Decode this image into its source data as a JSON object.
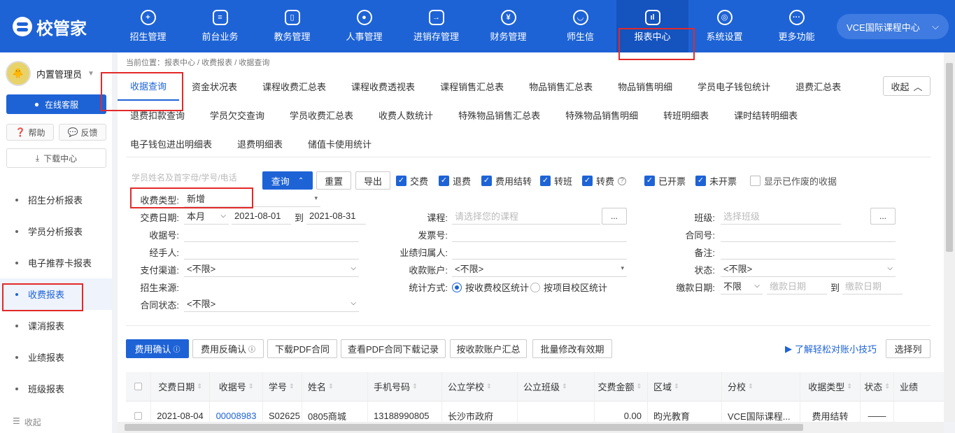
{
  "header": {
    "brand": "校管家",
    "nav": [
      {
        "label": "招生管理",
        "icon": "person-add-icon",
        "glyph": "+"
      },
      {
        "label": "前台业务",
        "icon": "desk-icon",
        "glyph": "≡"
      },
      {
        "label": "教务管理",
        "icon": "book-icon",
        "glyph": "▯"
      },
      {
        "label": "人事管理",
        "icon": "person-icon",
        "glyph": "●"
      },
      {
        "label": "进销存管理",
        "icon": "inventory-icon",
        "glyph": "→"
      },
      {
        "label": "财务管理",
        "icon": "yen-icon",
        "glyph": "¥"
      },
      {
        "label": "师生信",
        "icon": "chat-icon",
        "glyph": "◡"
      },
      {
        "label": "报表中心",
        "icon": "report-icon",
        "glyph": "ıl"
      },
      {
        "label": "系统设置",
        "icon": "settings-icon",
        "glyph": "◎"
      },
      {
        "label": "更多功能",
        "icon": "more-icon",
        "glyph": "···"
      }
    ],
    "org": "VCE国际课程中心"
  },
  "sidebar": {
    "user": "内置管理员",
    "service": "在线客服",
    "help": "帮助",
    "feedback": "反馈",
    "download": "下载中心",
    "items": [
      "招生分析报表",
      "学员分析报表",
      "电子推荐卡报表",
      "收费报表",
      "课消报表",
      "业绩报表",
      "班级报表"
    ],
    "collapse": "收起"
  },
  "breadcrumb": "当前位置：报表中心 / 收费报表 / 收据查询",
  "tabs": {
    "row1": [
      "收据查询",
      "资金状况表",
      "课程收费汇总表",
      "课程收费透视表",
      "课程销售汇总表",
      "物品销售汇总表",
      "物品销售明细",
      "学员电子钱包统计",
      "退费汇总表"
    ],
    "row2": [
      "退费扣款查询",
      "学员欠交查询",
      "学员收费汇总表",
      "收费人数统计",
      "特殊物品销售汇总表",
      "特殊物品销售明细",
      "转班明细表",
      "课时结转明细表"
    ],
    "row3": [
      "电子钱包进出明细表",
      "退费明细表",
      "储值卡使用统计"
    ],
    "fold": "收起"
  },
  "filters": {
    "search_placeholder": "学员姓名及首字母/学号/电话",
    "query": "查询",
    "reset": "重置",
    "export": "导出",
    "checks": [
      "交费",
      "退费",
      "费用结转",
      "转班",
      "转费",
      "已开票",
      "未开票"
    ],
    "show_void": "显示已作废的收据",
    "fee_type_label": "收费类型:",
    "fee_type": "新增",
    "date_label": "交费日期:",
    "date_range": "本月",
    "date_from": "2021-08-01",
    "to": "到",
    "date_to": "2021-08-31",
    "course_label": "课程:",
    "course_ph": "请选择您的课程",
    "class_label": "班级:",
    "class_ph": "选择班级",
    "receipt_label": "收据号:",
    "invoice_label": "发票号:",
    "contract_label": "合同号:",
    "handler_label": "经手人:",
    "owner_label": "业绩归属人:",
    "remark_label": "备注:",
    "pay_label": "支付渠道:",
    "pay": "<不限>",
    "account_label": "收款账户:",
    "account": "<不限>",
    "status_label": "状态:",
    "status": "<不限>",
    "source_label": "招生来源:",
    "stat_label": "统计方式:",
    "stat_opt1": "按收费校区统计",
    "stat_opt2": "按项目校区统计",
    "paydate_label": "缴款日期:",
    "paydate_range": "不限",
    "paydate_from_ph": "缴款日期",
    "paydate_to_ph": "缴款日期",
    "contract_status_label": "合同状态:",
    "contract_status": "<不限>"
  },
  "actions": {
    "confirm": "费用确认",
    "unconfirm": "费用反确认",
    "download_pdf": "下载PDF合同",
    "pdf_log": "查看PDF合同下载记录",
    "by_account": "按收款账户汇总",
    "batch": "批量修改有效期",
    "tip_link": "了解轻松对账小技巧",
    "columns": "选择列"
  },
  "table": {
    "headers": [
      "交费日期",
      "收据号",
      "学号",
      "姓名",
      "手机号码",
      "公立学校",
      "公立班级",
      "交费金额",
      "区域",
      "分校",
      "收据类型",
      "状态",
      "业绩"
    ],
    "rows": [
      [
        "2021-08-04",
        "00008983",
        "S02625",
        "0805商城",
        "13188990805",
        "长沙市政府",
        "",
        "0.00",
        "昀光教育",
        "VCE国际课程...",
        "费用结转",
        "——",
        ""
      ]
    ]
  }
}
